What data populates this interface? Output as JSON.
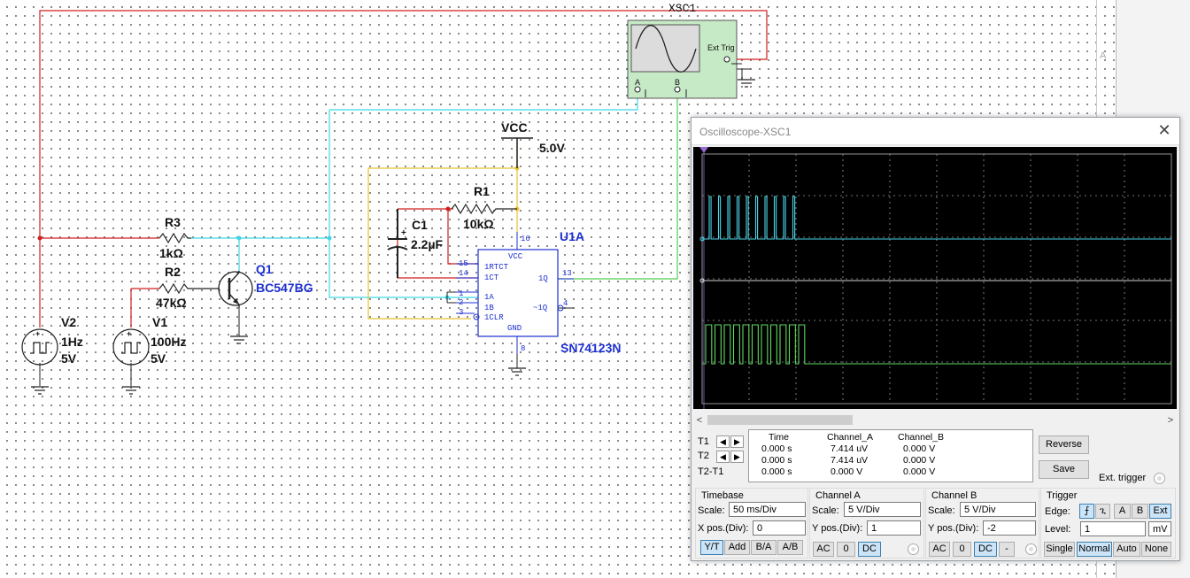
{
  "schematic": {
    "scope_name": "XSC1",
    "ext_trig_label": "Ext Trig",
    "channel_a_pin": "A",
    "channel_b_pin": "B",
    "right_marker": "A",
    "vcc_label": "VCC",
    "vcc_value": "5.0V",
    "r1_name": "R1",
    "r1_value": "10kΩ",
    "c1_name": "C1",
    "c1_value": "2.2µF",
    "r3_name": "R3",
    "r3_value": "1kΩ",
    "r2_name": "R2",
    "r2_value": "47kΩ",
    "q1_name": "Q1",
    "q1_part": "BC547BG",
    "v2_name": "V2",
    "v2_freq": "1Hz",
    "v2_amp": "5V",
    "v1_name": "V1",
    "v1_freq": "100Hz",
    "v1_amp": "5V",
    "u1_name": "U1A",
    "u1_part": "SN74123N",
    "ic_pins": {
      "vcc_pin": "VCC",
      "rtct": "1RTCT",
      "ct": "1CT",
      "a": "1A",
      "b": "1B",
      "clr": "1CLR",
      "gnd": "GND",
      "q": "1Q",
      "qbar": "~1Q",
      "n16": "16",
      "n15": "15",
      "n14": "14",
      "n1": "1",
      "n2": "2",
      "n3": "3",
      "n13": "13",
      "n4": "4",
      "n8": "8"
    }
  },
  "oscilloscope": {
    "title": "Oscilloscope-XSC1",
    "cursor_rows": [
      "T1",
      "T2",
      "T2-T1"
    ],
    "columns": [
      "Time",
      "Channel_A",
      "Channel_B"
    ],
    "rows": [
      [
        "0.000 s",
        "7.414 uV",
        "0.000 V"
      ],
      [
        "0.000 s",
        "7.414 uV",
        "0.000 V"
      ],
      [
        "0.000 s",
        "0.000 V",
        "0.000 V"
      ]
    ],
    "reverse_label": "Reverse",
    "save_label": "Save",
    "ext_trigger_label": "Ext. trigger",
    "timebase": {
      "title": "Timebase",
      "scale_label": "Scale:",
      "scale": "50 ms/Div",
      "xpos_label": "X pos.(Div):",
      "xpos": "0",
      "buttons": [
        "Y/T",
        "Add",
        "B/A",
        "A/B"
      ],
      "selected": "Y/T"
    },
    "channel_a": {
      "title": "Channel A",
      "scale_label": "Scale:",
      "scale": "5  V/Div",
      "ypos_label": "Y pos.(Div):",
      "ypos": "1",
      "coupling": [
        "AC",
        "0",
        "DC"
      ],
      "selected": "DC",
      "color": "#49d6e8"
    },
    "channel_b": {
      "title": "Channel B",
      "scale_label": "Scale:",
      "scale": "5  V/Div",
      "ypos_label": "Y pos.(Div):",
      "ypos": "-2",
      "coupling": [
        "AC",
        "0",
        "DC",
        "-"
      ],
      "selected": "DC",
      "color": "#5fd85f"
    },
    "trigger": {
      "title": "Trigger",
      "edge_label": "Edge:",
      "edge_buttons": [
        "rising-edge-icon",
        "falling-edge-icon",
        "A",
        "B",
        "Ext"
      ],
      "level_label": "Level:",
      "level": "1",
      "level_unit": "mV",
      "modes": [
        "Single",
        "Normal",
        "Auto",
        "None"
      ],
      "selected_mode": "Normal"
    }
  }
}
